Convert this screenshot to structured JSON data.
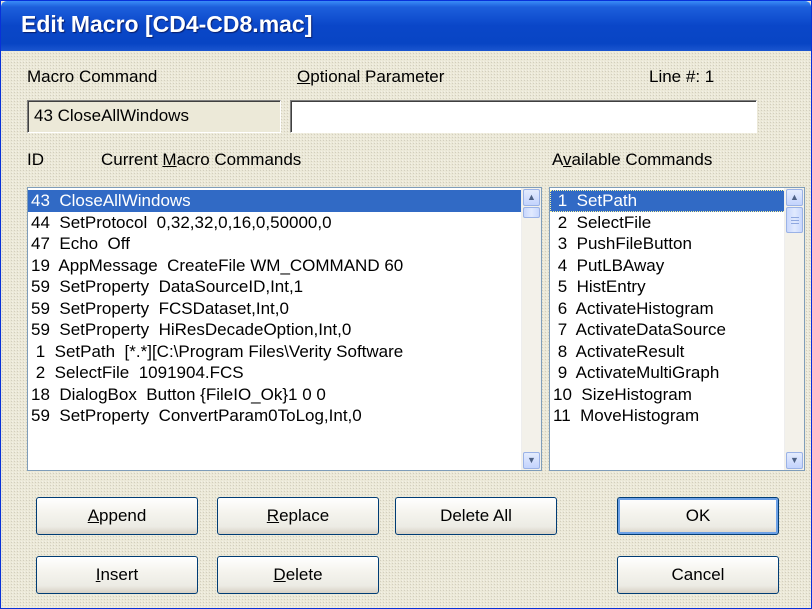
{
  "window": {
    "title": "Edit Macro [CD4-CD8.mac]"
  },
  "labels": {
    "macro_command": "Macro Command",
    "optional_parameter_pre": "",
    "optional_parameter_mnemonic": "O",
    "optional_parameter_post": "ptional Parameter",
    "line_number": "Line #:  1",
    "id": "ID",
    "current_pre": "Current ",
    "current_mnemonic": "M",
    "current_post": "acro Commands",
    "available_pre": "A",
    "available_mnemonic": "v",
    "available_post": "ailable Commands"
  },
  "macro_command_value": "43  CloseAllWindows",
  "optional_parameter_value": "",
  "current_commands": [
    "43  CloseAllWindows",
    "44  SetProtocol  0,32,32,0,16,0,50000,0",
    "47  Echo  Off",
    "19  AppMessage  CreateFile WM_COMMAND 60",
    "59  SetProperty  DataSourceID,Int,1",
    "59  SetProperty  FCSDataset,Int,0",
    "59  SetProperty  HiResDecadeOption,Int,0",
    " 1  SetPath  [*.*][C:\\Program Files\\Verity Software",
    " 2  SelectFile  1091904.FCS",
    "18  DialogBox  Button {FileIO_Ok}1 0 0",
    "59  SetProperty  ConvertParam0ToLog,Int,0"
  ],
  "current_selected_index": 0,
  "available_commands": [
    " 1  SetPath",
    " 2  SelectFile",
    " 3  PushFileButton",
    " 4  PutLBAway",
    " 5  HistEntry",
    " 6  ActivateHistogram",
    " 7  ActivateDataSource",
    " 8  ActivateResult",
    " 9  ActivateMultiGraph",
    "10  SizeHistogram",
    "11  MoveHistogram"
  ],
  "available_selected_index": 0,
  "buttons": {
    "append": {
      "mnemonic": "A",
      "rest": "ppend"
    },
    "replace": {
      "mnemonic": "R",
      "rest": "eplace"
    },
    "delete_all": {
      "label": "Delete All"
    },
    "ok": {
      "label": "OK"
    },
    "insert": {
      "mnemonic": "I",
      "rest": "nsert"
    },
    "delete": {
      "mnemonic": "D",
      "rest": "elete"
    },
    "cancel": {
      "label": "Cancel"
    }
  },
  "icons": {
    "scroll_up": "scroll-up-arrow-icon",
    "scroll_down": "scroll-down-arrow-icon"
  },
  "colors": {
    "title_bar": "#0a46c8",
    "selection": "#316ac5",
    "face": "#ece9d8"
  }
}
